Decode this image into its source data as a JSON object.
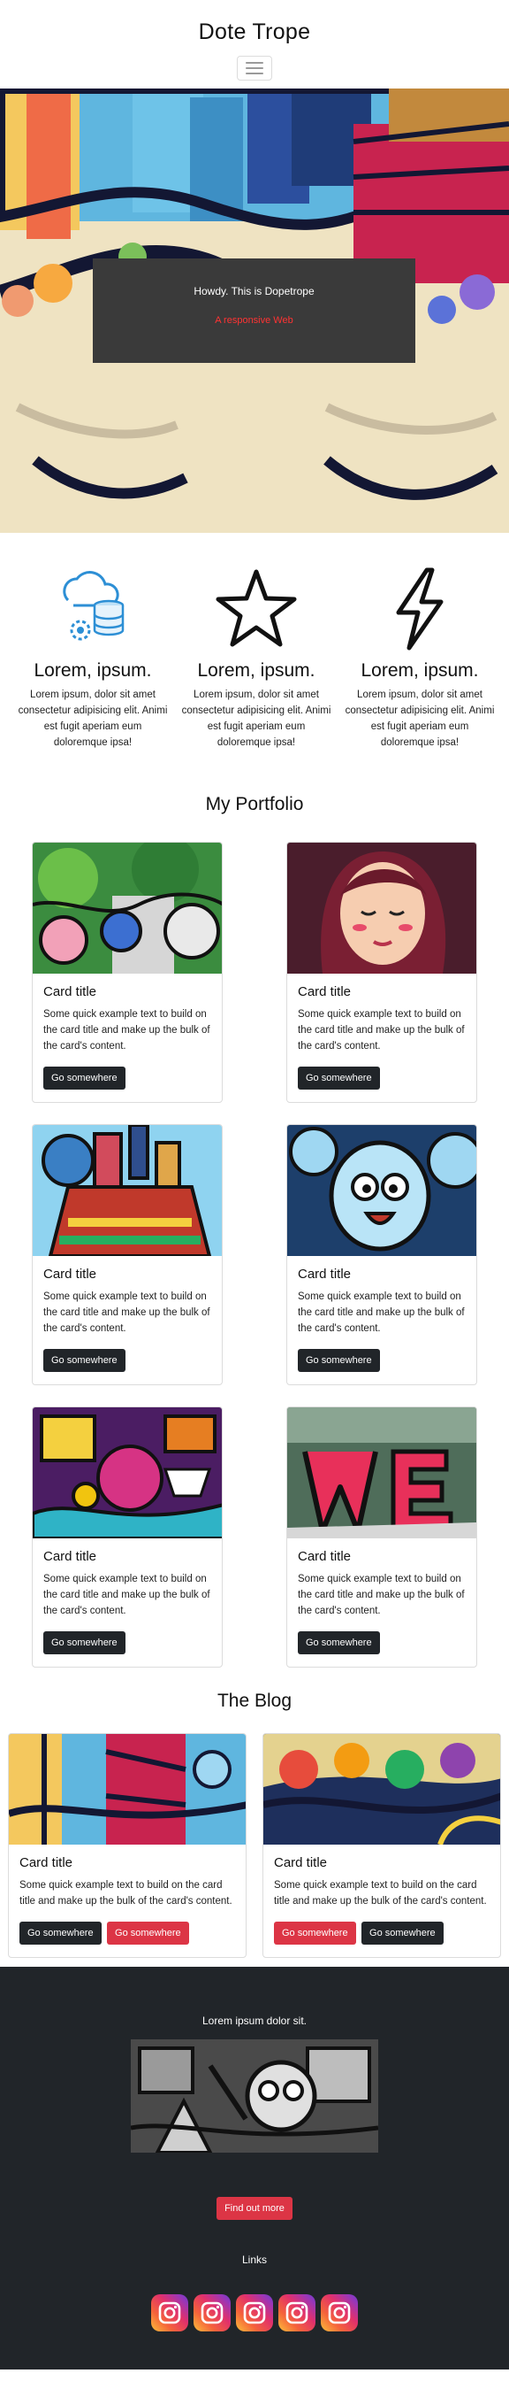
{
  "nav": {
    "brand": "Dote Trope"
  },
  "hero": {
    "title": "Howdy. This is Dopetrope",
    "subtitle": "A responsive Web"
  },
  "features": [
    {
      "icon": "cloud-database-icon",
      "title": "Lorem, ipsum.",
      "text": "Lorem ipsum, dolor sit amet consectetur adipisicing elit. Animi est fugit aperiam eum doloremque ipsa!"
    },
    {
      "icon": "star-icon",
      "title": "Lorem, ipsum.",
      "text": "Lorem ipsum, dolor sit amet consectetur adipisicing elit. Animi est fugit aperiam eum doloremque ipsa!"
    },
    {
      "icon": "lightning-icon",
      "title": "Lorem, ipsum.",
      "text": "Lorem ipsum, dolor sit amet consectetur adipisicing elit. Animi est fugit aperiam eum doloremque ipsa!"
    }
  ],
  "portfolio": {
    "title": "My Portfolio",
    "cards": [
      {
        "title": "Card title",
        "text": "Some quick example text to build on the card title and make up the bulk of the card's content.",
        "button": "Go somewhere"
      },
      {
        "title": "Card title",
        "text": "Some quick example text to build on the card title and make up the bulk of the card's content.",
        "button": "Go somewhere"
      },
      {
        "title": "Card title",
        "text": "Some quick example text to build on the card title and make up the bulk of the card's content.",
        "button": "Go somewhere"
      },
      {
        "title": "Card title",
        "text": "Some quick example text to build on the card title and make up the bulk of the card's content.",
        "button": "Go somewhere"
      },
      {
        "title": "Card title",
        "text": "Some quick example text to build on the card title and make up the bulk of the card's content.",
        "button": "Go somewhere"
      },
      {
        "title": "Card title",
        "text": "Some quick example text to build on the card title and make up the bulk of the card's content.",
        "button": "Go somewhere"
      }
    ]
  },
  "blog": {
    "title": "The Blog",
    "cards": [
      {
        "title": "Card title",
        "text": "Some quick example text to build on the card title and make up the bulk of the card's content.",
        "button1": "Go somewhere",
        "button2": "Go somewhere"
      },
      {
        "title": "Card title",
        "text": "Some quick example text to build on the card title and make up the bulk of the card's content.",
        "button1": "Go somewhere",
        "button2": "Go somewhere"
      }
    ]
  },
  "footer": {
    "lead": "Lorem ipsum dolor sit.",
    "cta": "Find out more",
    "links_label": "Links",
    "socials": [
      "instagram-icon",
      "instagram-icon",
      "instagram-icon",
      "instagram-icon",
      "instagram-icon"
    ]
  },
  "colors": {
    "dark": "#212529",
    "danger": "#dc3545",
    "hero_box": "#3a3a3a",
    "hero_subtitle": "#ff3333"
  }
}
